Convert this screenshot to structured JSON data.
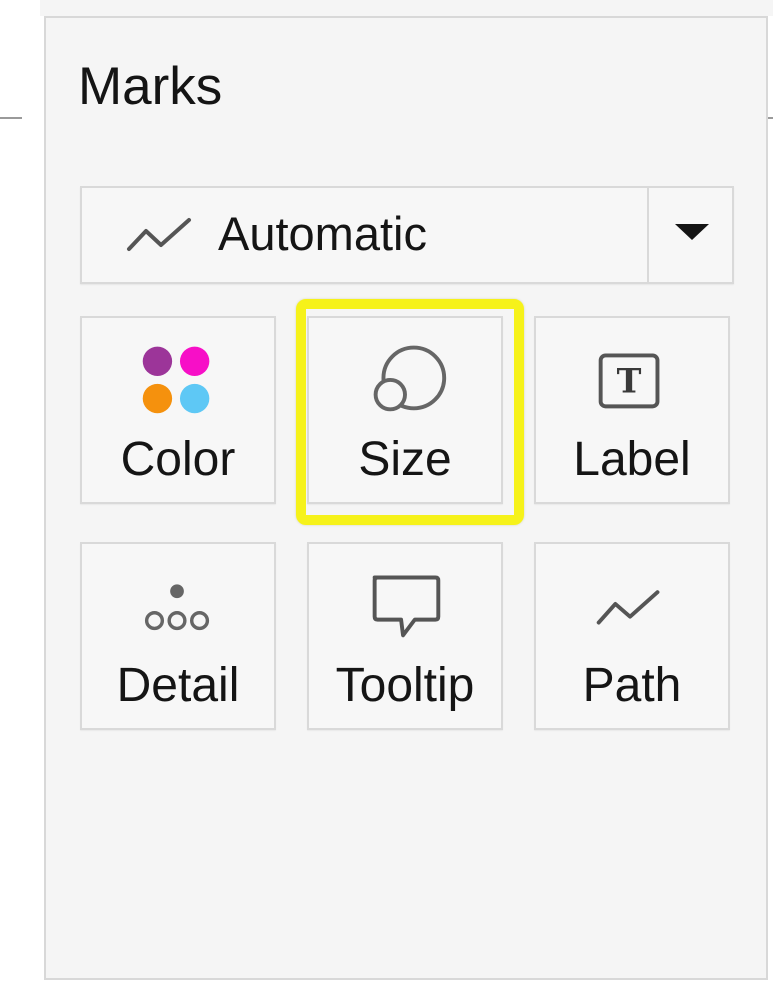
{
  "panel": {
    "title": "Marks"
  },
  "mark_type": {
    "selected": "Automatic",
    "icon": "line-icon"
  },
  "cards": {
    "color": {
      "label": "Color",
      "icon": "color-dots-icon",
      "dot_colors": [
        "#9c3599",
        "#f70fc7",
        "#f5910d",
        "#5ec8f5"
      ]
    },
    "size": {
      "label": "Size",
      "icon": "size-circles-icon",
      "highlighted": true,
      "highlight_color": "#f6f21a"
    },
    "label": {
      "label": "Label",
      "icon": "text-label-icon",
      "icon_text": "T"
    },
    "detail": {
      "label": "Detail",
      "icon": "detail-dots-icon"
    },
    "tooltip": {
      "label": "Tooltip",
      "icon": "speech-bubble-icon"
    },
    "path": {
      "label": "Path",
      "icon": "path-line-icon"
    }
  }
}
